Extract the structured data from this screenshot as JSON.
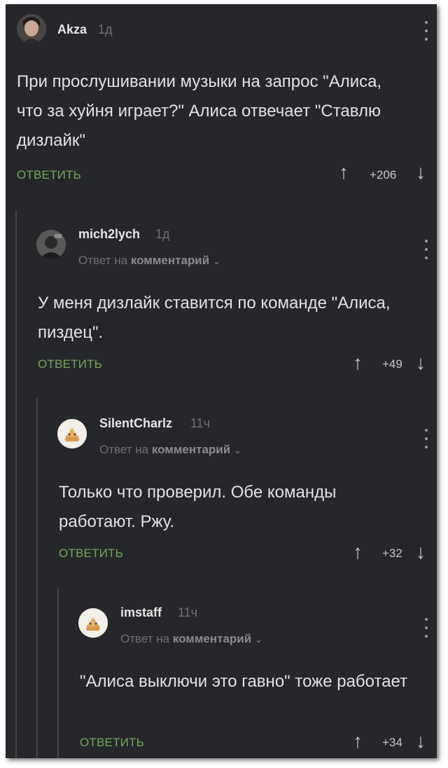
{
  "comments": [
    {
      "author": "Akza",
      "time": "1д",
      "text": "При прослушивании музыки на запрос \"Алиса, что за хуйня играет?\" Алиса отвечает \"Ставлю дизлайк\"",
      "reply_label": "ОТВЕТИТЬ",
      "score": "+206"
    },
    {
      "author": "mich2lych",
      "time": "1д",
      "reply_prefix": "Ответ на",
      "reply_target": "комментарий",
      "text": "У меня дизлайк ставится по команде \"Алиса, пиздец\".",
      "reply_label": "ОТВЕТИТЬ",
      "score": "+49"
    },
    {
      "author": "SilentCharlz",
      "time": "11ч",
      "reply_prefix": "Ответ на",
      "reply_target": "комментарий",
      "text": "Только что проверил. Обе команды работают. Ржу.",
      "reply_label": "ОТВЕТИТЬ",
      "score": "+32"
    },
    {
      "author": "imstaff",
      "time": "11ч",
      "reply_prefix": "Ответ на",
      "reply_target": "комментарий",
      "text": "\"Алиса выключи это гавно\" тоже работает",
      "reply_label": "ОТВЕТИТЬ",
      "score": "+34"
    }
  ],
  "icons": {
    "upvote": "arrow-up-icon",
    "downvote": "arrow-down-icon",
    "menu": "more-vertical-icon",
    "chevron": "chevron-down-icon"
  },
  "colors": {
    "background": "#26272b",
    "reply_button": "#73a85a",
    "text": "#e2e2e2",
    "muted": "#6f7075"
  }
}
